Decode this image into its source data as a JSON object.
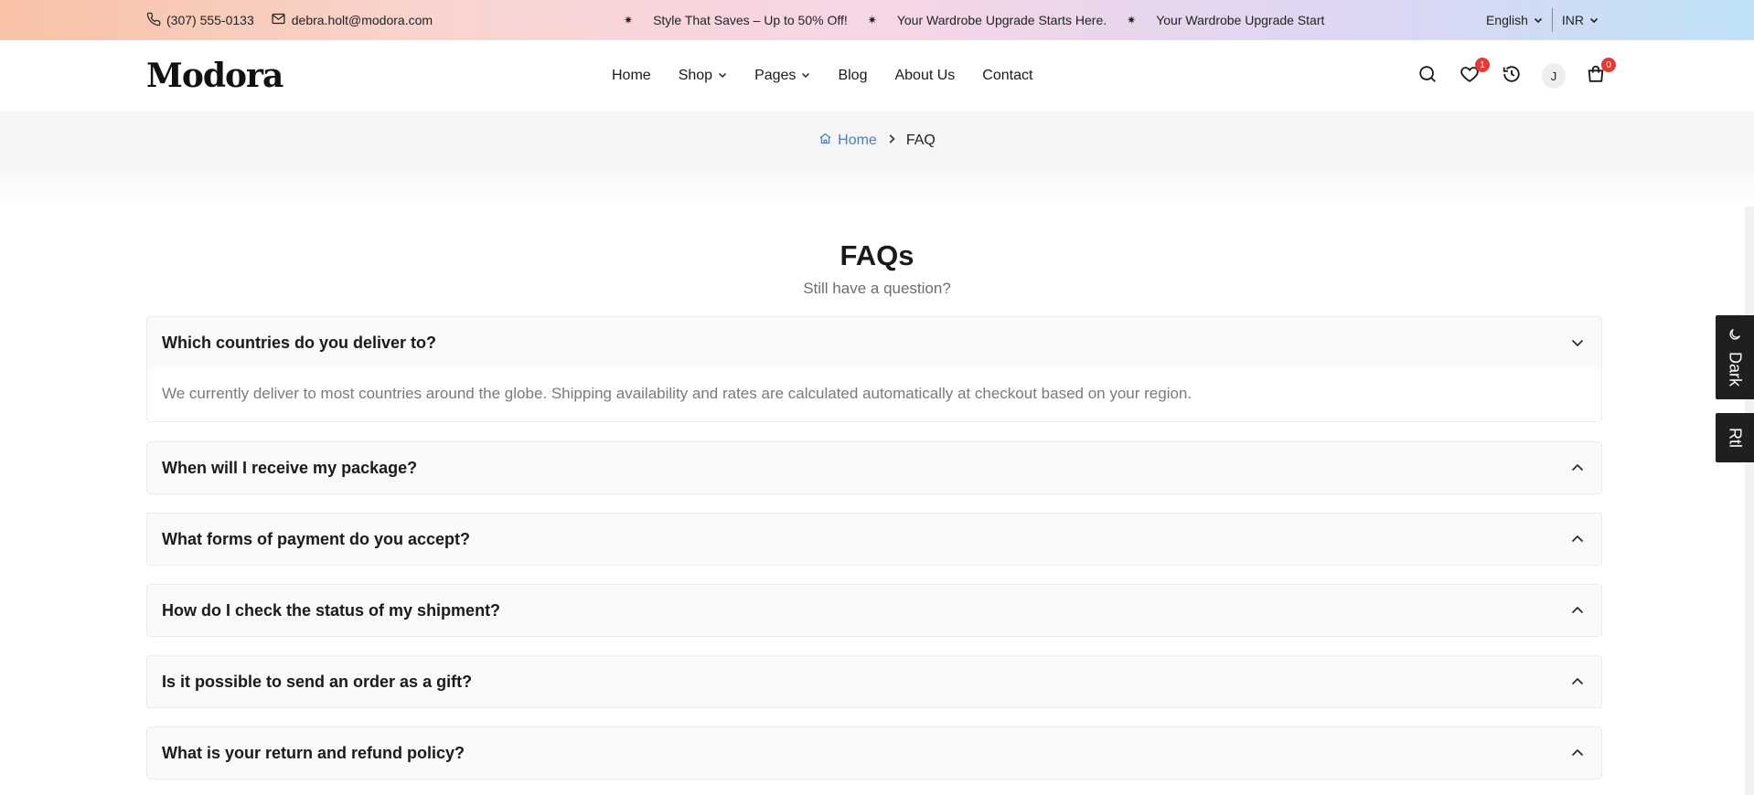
{
  "topbar": {
    "phone": "(307) 555-0133",
    "email": "debra.holt@modora.com",
    "promos": [
      "Style That Saves – Up to 50% Off!",
      "Your Wardrobe Upgrade Starts Here.",
      "Your Wardrobe Upgrade Start"
    ],
    "language": "English",
    "currency": "INR"
  },
  "header": {
    "logo": "Modora",
    "nav": [
      {
        "label": "Home",
        "dropdown": false
      },
      {
        "label": "Shop",
        "dropdown": true
      },
      {
        "label": "Pages",
        "dropdown": true
      },
      {
        "label": "Blog",
        "dropdown": false
      },
      {
        "label": "About Us",
        "dropdown": false
      },
      {
        "label": "Contact",
        "dropdown": false
      }
    ],
    "wishlist_count": "1",
    "avatar_initial": "J",
    "cart_count": "0"
  },
  "breadcrumb": {
    "home": "Home",
    "current": "FAQ"
  },
  "faq": {
    "title": "FAQs",
    "subtitle": "Still have a question?",
    "items": [
      {
        "question": "Which countries do you deliver to?",
        "answer": "We currently deliver to most countries around the globe. Shipping availability and rates are calculated automatically at checkout based on your region.",
        "expanded": true
      },
      {
        "question": "When will I receive my package?",
        "expanded": false
      },
      {
        "question": "What forms of payment do you accept?",
        "expanded": false
      },
      {
        "question": "How do I check the status of my shipment?",
        "expanded": false
      },
      {
        "question": "Is it possible to send an order as a gift?",
        "expanded": false
      },
      {
        "question": "What is your return and refund policy?",
        "expanded": false
      }
    ]
  },
  "side_tabs": {
    "dark": "Dark",
    "rtl": "Rtl"
  },
  "colors": {
    "accent_link": "#4a7fbf",
    "badge": "#e53935",
    "side_tab_bg": "#1f1f1f"
  }
}
